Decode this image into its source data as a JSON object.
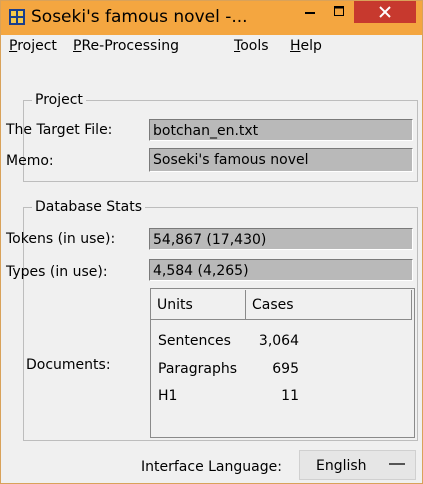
{
  "window": {
    "title": "Soseki's famous novel -...",
    "controls": {
      "minimize": "−",
      "maximize": "□",
      "close": "✕"
    },
    "colors": {
      "titlebar": "#f4a640",
      "close": "#c7392e"
    }
  },
  "menu": {
    "items": [
      {
        "accel": "P",
        "rest": "roject"
      },
      {
        "accel": "P",
        "rest": "Re-Processing"
      },
      {
        "accel": "T",
        "rest": "ools"
      },
      {
        "accel": "H",
        "rest": "elp"
      }
    ]
  },
  "project": {
    "group_title": "Project",
    "target_label": "The Target File:",
    "target_value": "botchan_en.txt",
    "memo_label": "Memo:",
    "memo_value": "Soseki's famous novel"
  },
  "stats": {
    "group_title": "Database Stats",
    "tokens_label": "Tokens (in use):",
    "tokens_value": "54,867 (17,430)",
    "types_label": "Types (in use):",
    "types_value": "4,584 (4,265)",
    "documents_label": "Documents:",
    "columns": [
      "Units",
      "Cases"
    ],
    "rows": [
      {
        "unit": "Sentences",
        "cases": "3,064"
      },
      {
        "unit": "Paragraphs",
        "cases": "695"
      },
      {
        "unit": "H1",
        "cases": "11"
      }
    ]
  },
  "footer": {
    "language_label": "Interface Language:",
    "language_value": "English"
  }
}
